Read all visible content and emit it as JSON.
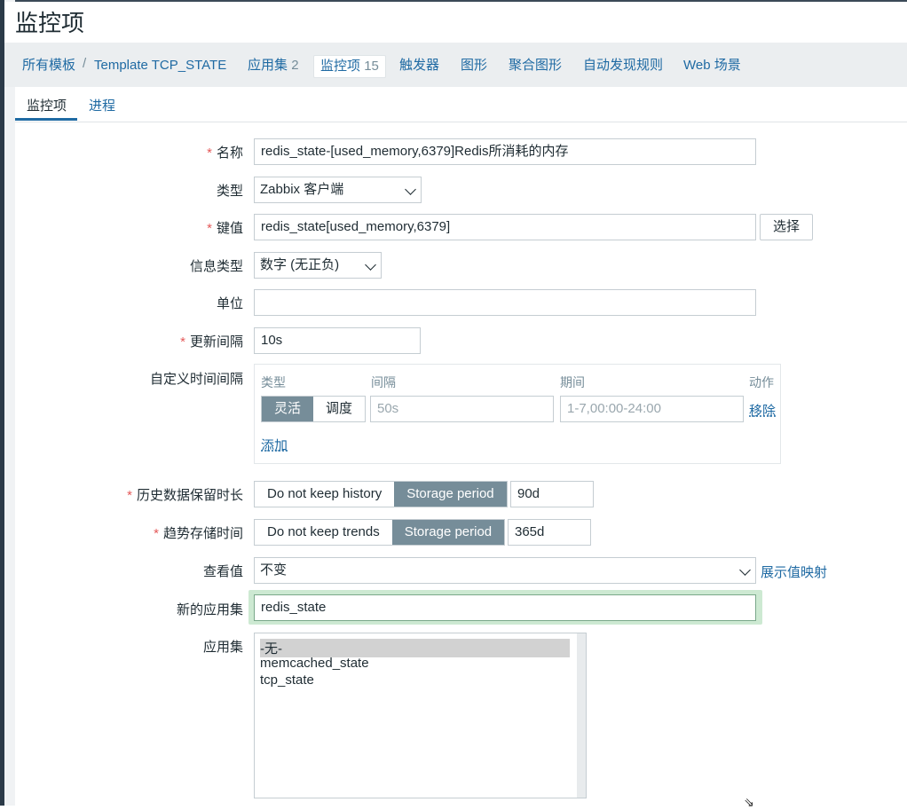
{
  "page": {
    "title": "监控项"
  },
  "nav": {
    "all_templates": "所有模板",
    "separator": "/",
    "template_name": "Template TCP_STATE",
    "applications": "应用集",
    "applications_count": "2",
    "items": "监控项",
    "items_count": "15",
    "triggers": "触发器",
    "graphs": "图形",
    "screens": "聚合图形",
    "discovery": "自动发现规则",
    "web": "Web 场景"
  },
  "tabs": [
    {
      "label": "监控项",
      "active": true
    },
    {
      "label": "进程",
      "active": false
    }
  ],
  "form": {
    "required_mark": "*",
    "name": {
      "label": "名称",
      "value": "redis_state-[used_memory,6379]Redis所消耗的内存"
    },
    "type": {
      "label": "类型",
      "value": "Zabbix 客户端"
    },
    "key": {
      "label": "键值",
      "value": "redis_state[used_memory,6379]",
      "button": "选择"
    },
    "info_type": {
      "label": "信息类型",
      "value": "数字 (无正负)"
    },
    "units": {
      "label": "单位",
      "value": ""
    },
    "update_interval": {
      "label": "更新间隔",
      "value": "10s"
    },
    "custom_intervals": {
      "label": "自定义时间间隔",
      "col_type": "类型",
      "col_interval": "间隔",
      "col_period": "期间",
      "col_action": "动作",
      "btn_flexible": "灵活",
      "btn_scheduling": "调度",
      "interval_placeholder": "50s",
      "period_placeholder": "1-7,00:00-24:00",
      "remove": "移除",
      "add": "添加"
    },
    "history": {
      "label": "历史数据保留时长",
      "opt_no": "Do not keep history",
      "opt_yes": "Storage period",
      "value": "90d"
    },
    "trends": {
      "label": "趋势存储时间",
      "opt_no": "Do not keep trends",
      "opt_yes": "Storage period",
      "value": "365d"
    },
    "show_value": {
      "label": "查看值",
      "value": "不变",
      "link": "展示值映射"
    },
    "new_application": {
      "label": "新的应用集",
      "value": "redis_state"
    },
    "applications": {
      "label": "应用集",
      "options": [
        "-无-",
        "memcached_state",
        "tcp_state"
      ],
      "selected_index": 0
    }
  },
  "colors": {
    "link": "#1f6aa3",
    "required": "#e45959",
    "segment_active": "#768d99",
    "focus": "#cde9d2"
  }
}
